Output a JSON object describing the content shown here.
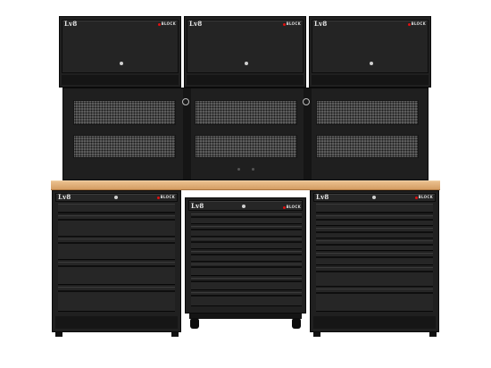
{
  "image": {
    "subject": "Black modular garage workbench with wall cabinets",
    "background": "#ffffff",
    "colors": {
      "cabinet": "#202020",
      "pegboard": "#5c5c5c",
      "worktop": "#dcaa70",
      "accent": "#cc1111"
    }
  },
  "labels": {
    "logo": "Lv8",
    "brand": "BLOCK"
  },
  "icons": [
    "lock-icon",
    "power-outlet-icon",
    "caster-wheel-icon",
    "logo-mark-icon"
  ]
}
